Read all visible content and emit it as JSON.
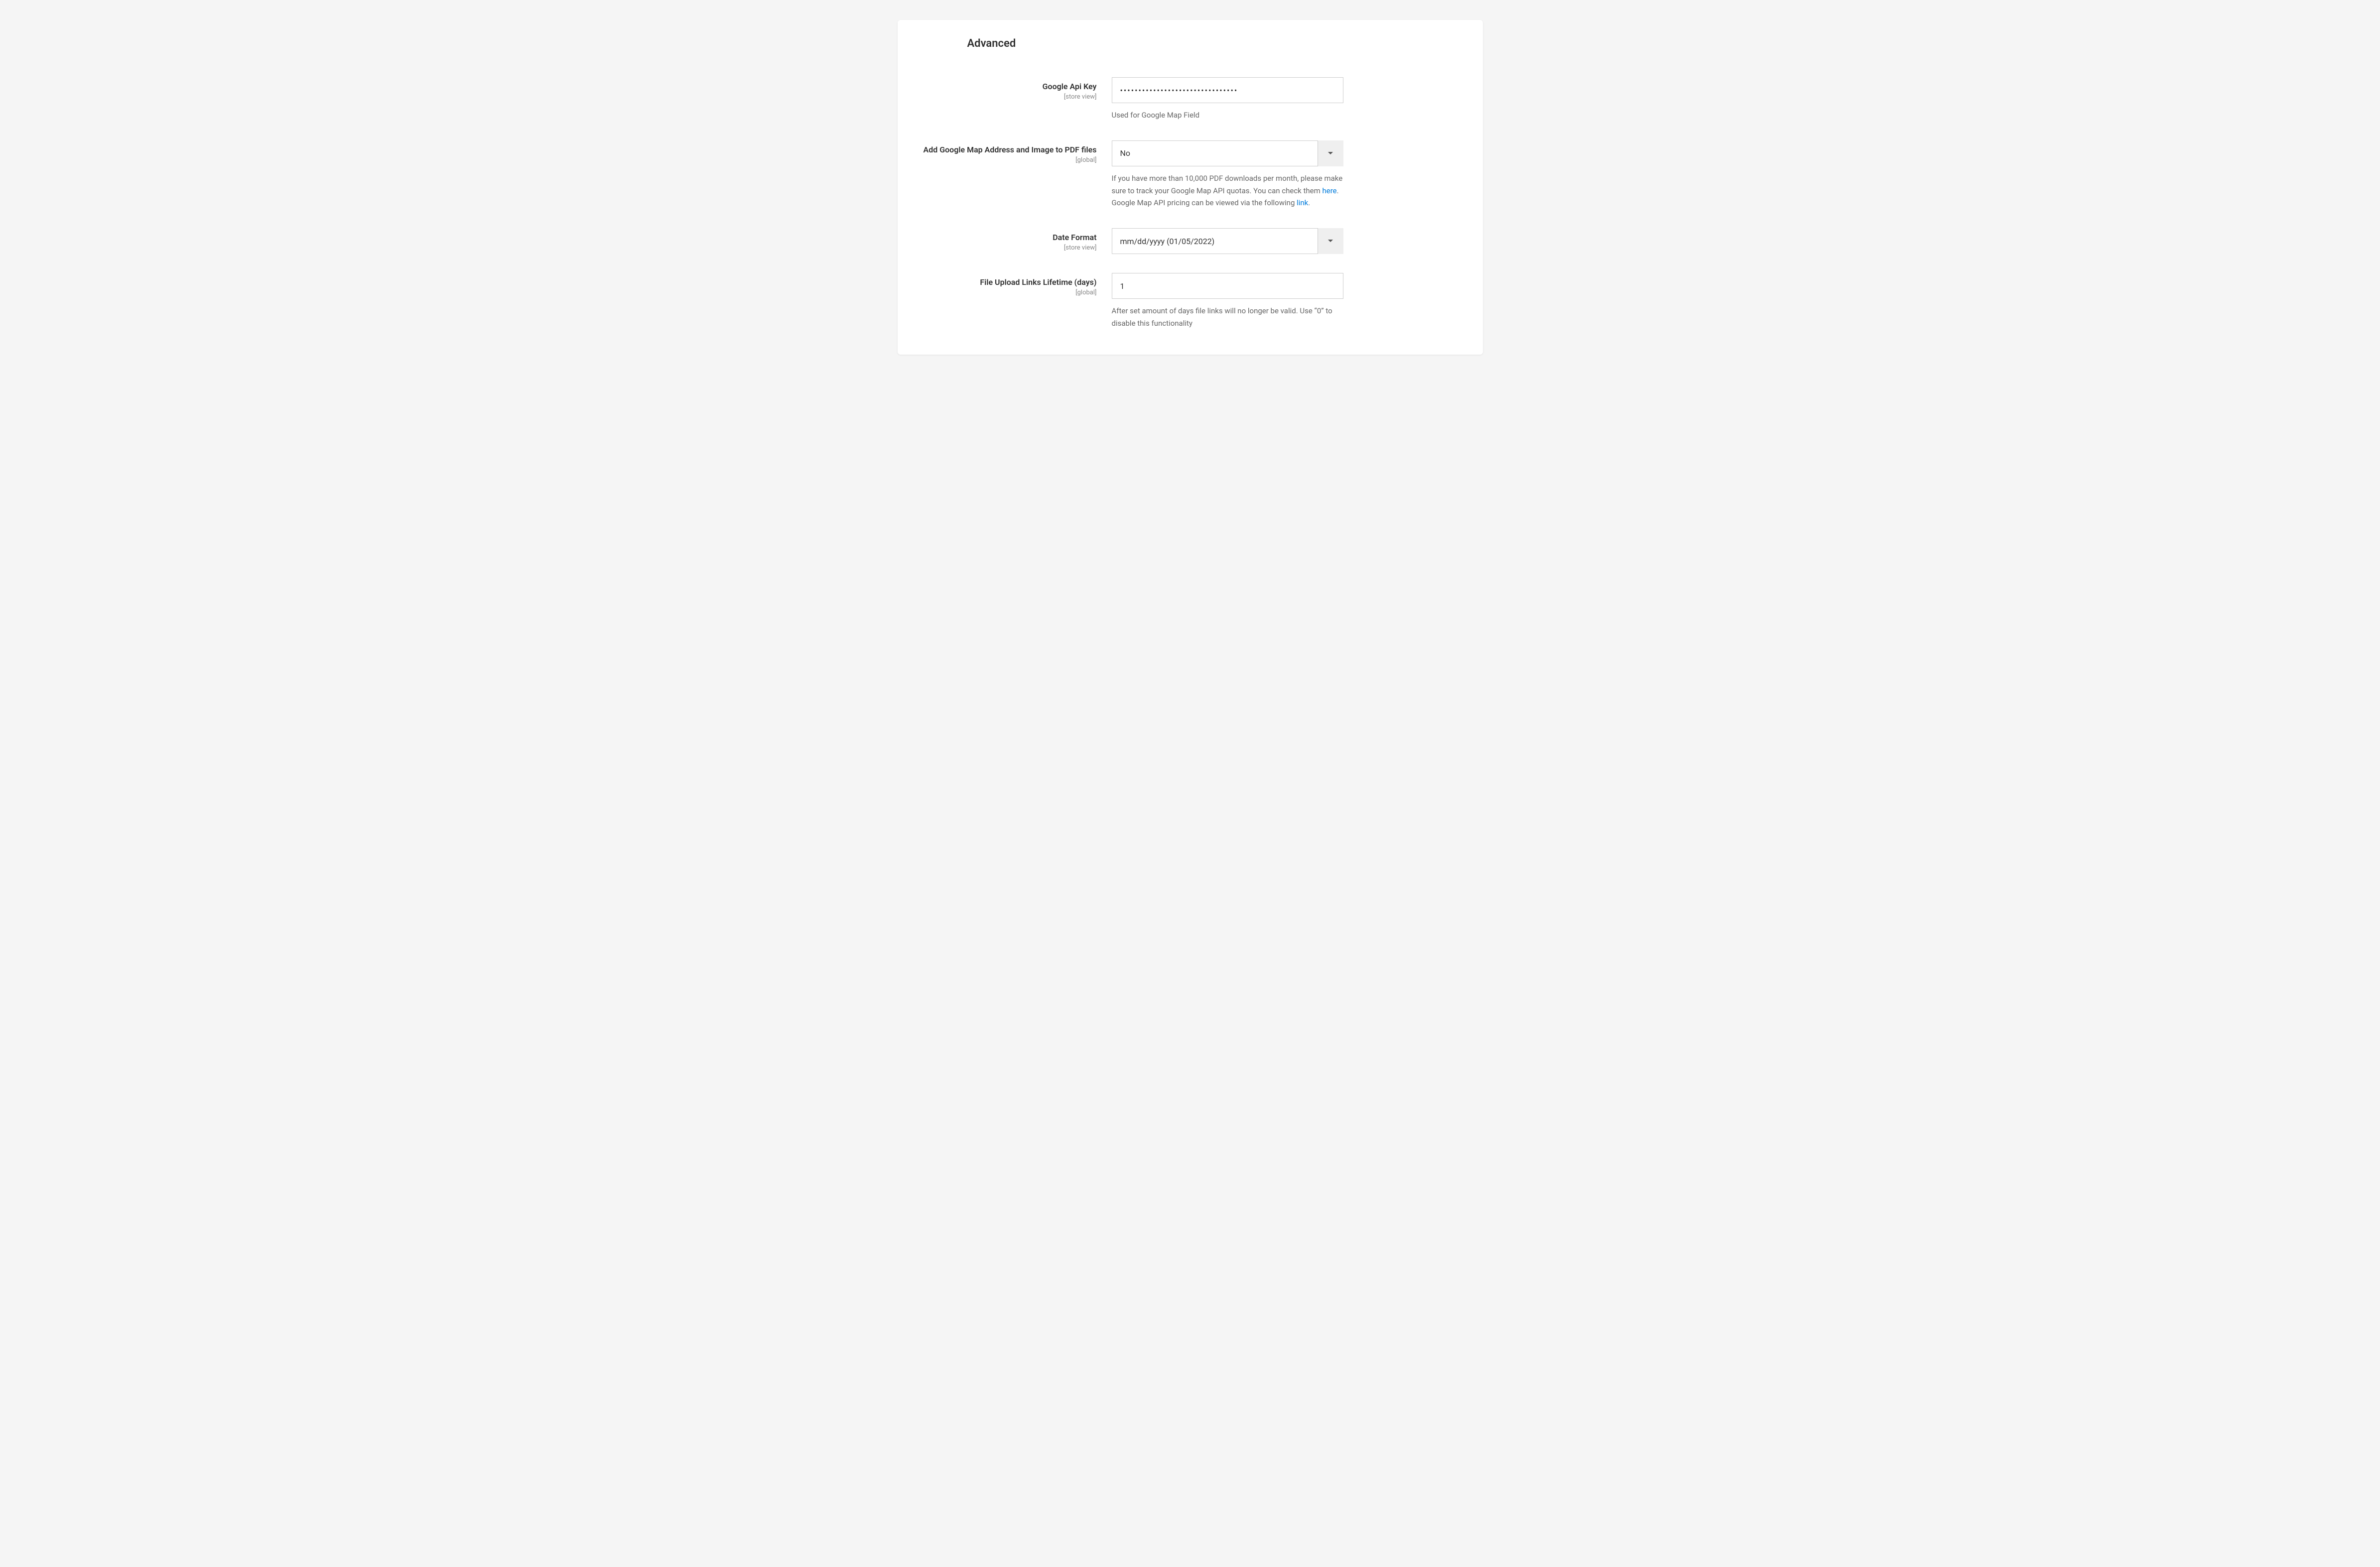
{
  "panel": {
    "title": "Advanced"
  },
  "fields": {
    "google_api_key": {
      "label": "Google Api Key",
      "scope": "[store view]",
      "value": "••••••••••••••••••••••••••••••••",
      "help": "Used for Google Map Field"
    },
    "add_google_map_pdf": {
      "label": "Add Google Map Address and Image to PDF files",
      "scope": "[global]",
      "value": "No",
      "help_part1": "If you have more than 10,000 PDF downloads per month, please make sure to track your Google Map API quotas. You can check them ",
      "help_link1": "here",
      "help_part2": ". Google Map API pricing can be viewed via the following ",
      "help_link2": "link",
      "help_part3": "."
    },
    "date_format": {
      "label": "Date Format",
      "scope": "[store view]",
      "value": "mm/dd/yyyy (01/05/2022)"
    },
    "file_upload_lifetime": {
      "label": "File Upload Links Lifetime (days)",
      "scope": "[global]",
      "value": "1",
      "help": "After set amount of days file links will no longer be valid. Use “0” to disable this functionality"
    }
  }
}
